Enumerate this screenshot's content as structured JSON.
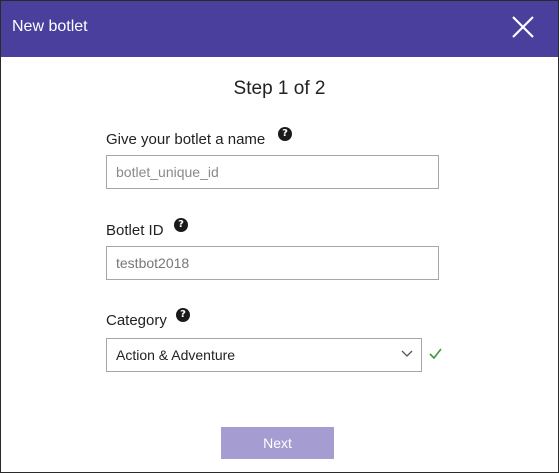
{
  "dialog": {
    "title": "New botlet",
    "close_icon": "close-icon",
    "header_color": "#4b3f9e"
  },
  "step": {
    "label": "Step 1 of 2"
  },
  "fields": {
    "name": {
      "label": "Give your botlet a name",
      "help_icon": "question-icon",
      "placeholder": "botlet_unique_id",
      "value": ""
    },
    "botlet_id": {
      "label": "Botlet ID",
      "help_icon": "question-icon",
      "value": "testbot2018"
    },
    "category": {
      "label": "Category",
      "help_icon": "question-icon",
      "selected": "Action & Adventure",
      "dropdown_icon": "chevron-down-icon",
      "valid_icon": "checkmark-icon",
      "valid_color": "#3a9a3a"
    }
  },
  "actions": {
    "next_label": "Next",
    "next_color": "#a59dd1",
    "next_enabled": false
  }
}
